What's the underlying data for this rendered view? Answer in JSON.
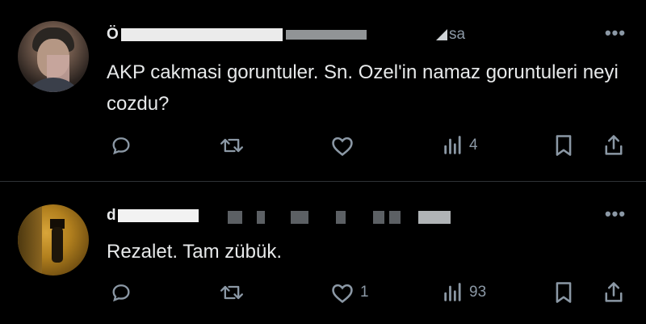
{
  "tweets": [
    {
      "display_name": "Ö",
      "handle_suffix": "sa",
      "text": "AKP cakmasi goruntuler. Sn. Ozel'in namaz goruntuleri neyi cozdu?",
      "more_glyph": "•••",
      "actions": {
        "reply": "",
        "retweet": "",
        "like": "",
        "views": "4"
      }
    },
    {
      "display_name": "d",
      "text": "Rezalet. Tam zübük.",
      "more_glyph": "•••",
      "actions": {
        "reply": "",
        "retweet": "",
        "like": "1",
        "views": "93"
      }
    }
  ],
  "icons": [
    "reply-icon",
    "retweet-icon",
    "like-icon",
    "views-icon",
    "bookmark-icon",
    "share-icon"
  ],
  "colors": {
    "background": "#000000",
    "text": "#e7e9ea",
    "muted": "#8b98a5",
    "redaction": "#ffffff",
    "divider": "#2f3336"
  }
}
